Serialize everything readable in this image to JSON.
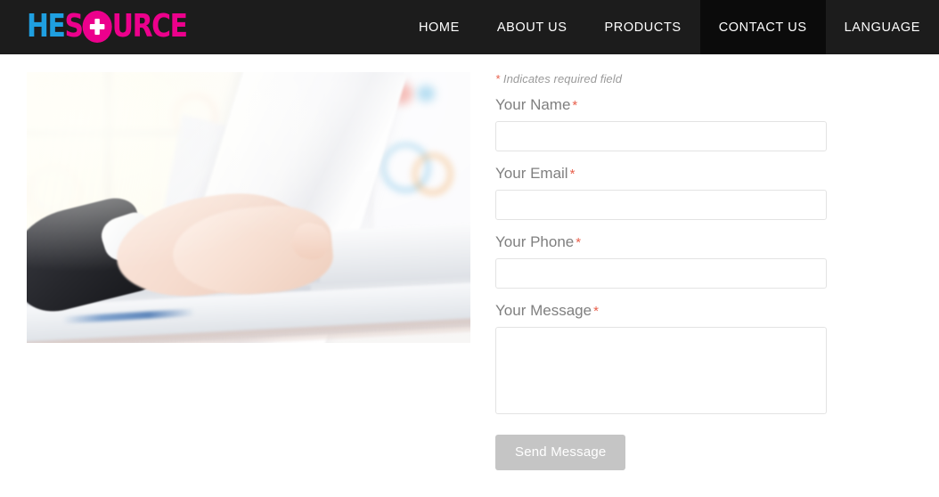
{
  "header": {
    "logo": {
      "part1": "HE",
      "part2": "S",
      "icon": "plus-circle-icon",
      "part3": "URCE",
      "color_part1": "#1f9fe0",
      "color_part2": "#ec008c",
      "color_part3": "#ec008c"
    },
    "background": "#1c1c1c",
    "nav": [
      {
        "label": "HOME",
        "active": false
      },
      {
        "label": "ABOUT US",
        "active": false
      },
      {
        "label": "PRODUCTS",
        "active": false
      },
      {
        "label": "CONTACT US",
        "active": true
      },
      {
        "label": "LANGUAGE",
        "active": false
      }
    ]
  },
  "main": {
    "image": {
      "alt": "Businessperson hands typing on a white laptop in a bright office with blurred charts in the background"
    },
    "form": {
      "required_note_star": "*",
      "required_note": " Indicates required field",
      "fields": [
        {
          "label": "Your Name",
          "star": "*",
          "value": "",
          "placeholder": "",
          "type": "text"
        },
        {
          "label": "Your Email",
          "star": "*",
          "value": "",
          "placeholder": "",
          "type": "text"
        },
        {
          "label": "Your Phone",
          "star": "*",
          "value": "",
          "placeholder": "",
          "type": "text"
        },
        {
          "label": "Your Message",
          "star": "*",
          "value": "",
          "placeholder": "",
          "type": "textarea"
        }
      ],
      "submit_label": "Send Message",
      "submit_color": "#c5c5c5",
      "label_color": "#7f7f7f",
      "star_color": "#e8604c"
    }
  }
}
